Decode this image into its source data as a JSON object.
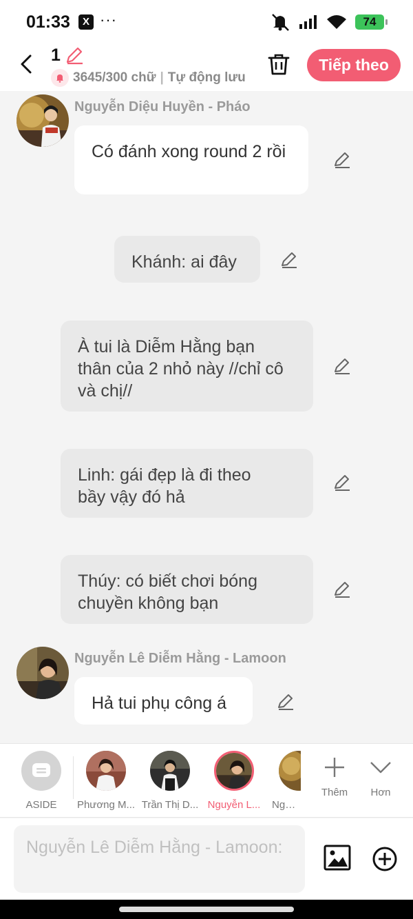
{
  "status_bar": {
    "time": "01:33",
    "app_icon": "X",
    "more": "···",
    "battery": "74"
  },
  "header": {
    "doc_title": "1",
    "word_count": "3645/300 chữ",
    "separator": "|",
    "autosave": "Tự động lưu",
    "next_label": "Tiếp theo"
  },
  "messages": [
    {
      "sender": "Nguyễn Diệu Huyền - Pháo",
      "text": "Có đánh xong round 2 rồi"
    },
    {
      "text": "Khánh: ai đây"
    },
    {
      "text": "À tui là Diễm Hằng bạn thân của 2 nhỏ này //chỉ cô và chị//"
    },
    {
      "text": "Linh: gái đẹp là đi theo bầy vậy đó hả"
    },
    {
      "text": "Thúy: có biết chơi bóng chuyền không bạn"
    },
    {
      "sender": "Nguyễn Lê Diễm Hằng - Lamoon",
      "text": "Hả tui phụ công á"
    }
  ],
  "characters": [
    {
      "name": "ASIDE"
    },
    {
      "name": "Phương M..."
    },
    {
      "name": "Trần Thị D..."
    },
    {
      "name": "Nguyễn L..."
    },
    {
      "name": "Nguyễ"
    }
  ],
  "tools": {
    "add_label": "Thêm",
    "more_label": "Hơn"
  },
  "input": {
    "placeholder": "Nguyễn Lê Diễm Hằng - Lamoon:"
  },
  "colors": {
    "accent": "#f25d73",
    "bubble_white": "#ffffff",
    "bubble_grey": "#e9e9e9",
    "background": "#f4f4f4"
  }
}
